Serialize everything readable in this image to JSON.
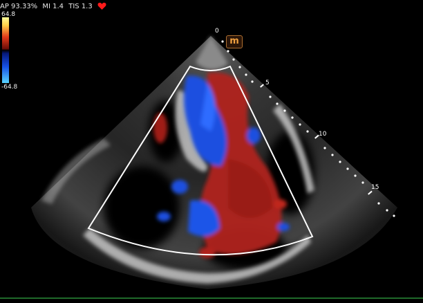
{
  "status": {
    "ap": "AP 93.33%",
    "mi": "MI 1.4",
    "tis": "TIS 1.3",
    "heart_icon": "heart-icon"
  },
  "colorbar": {
    "max_label": "64.8",
    "min_label": "-64.8"
  },
  "depth_scale": {
    "labels": [
      "0",
      "5",
      "10",
      "15"
    ]
  },
  "orientation_marker": {
    "label": "m"
  },
  "colors": {
    "doppler_red": "#b0221a",
    "doppler_blue": "#1e4fe0",
    "baseline": "#1f6a2a"
  }
}
